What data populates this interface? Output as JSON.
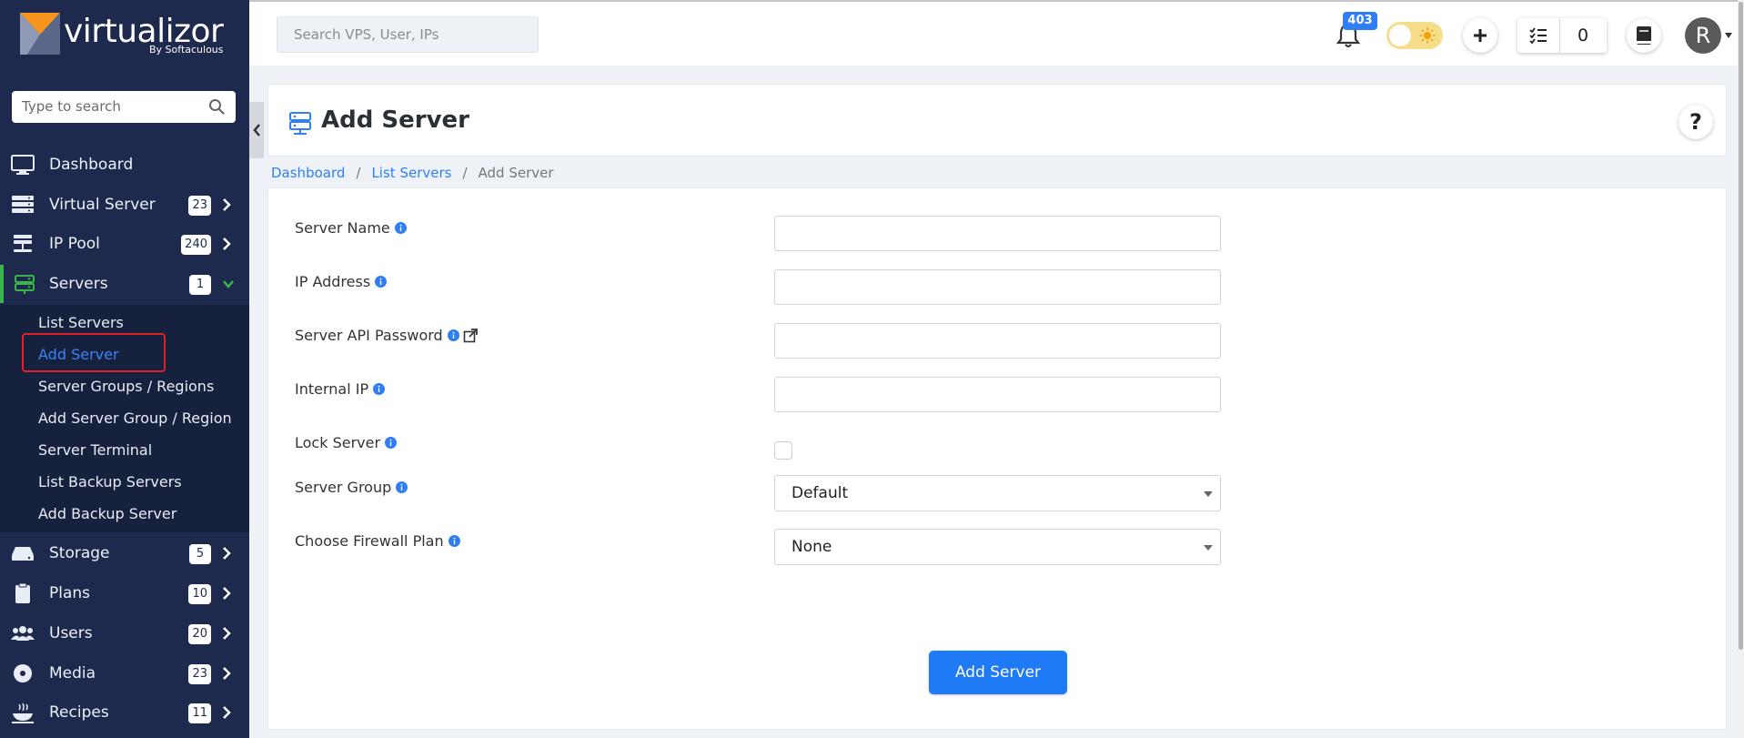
{
  "logo": {
    "name": "virtualizor",
    "by": "By Softaculous"
  },
  "sidebar": {
    "search_placeholder": "Type to search",
    "items": [
      {
        "label": "Dashboard",
        "badge": null
      },
      {
        "label": "Virtual Server",
        "badge": "23"
      },
      {
        "label": "IP Pool",
        "badge": "240"
      },
      {
        "label": "Servers",
        "badge": "1"
      },
      {
        "label": "Storage",
        "badge": "5"
      },
      {
        "label": "Plans",
        "badge": "10"
      },
      {
        "label": "Users",
        "badge": "20"
      },
      {
        "label": "Media",
        "badge": "23"
      },
      {
        "label": "Recipes",
        "badge": "11"
      }
    ],
    "servers_submenu": [
      "List Servers",
      "Add Server",
      "Server Groups / Regions",
      "Add Server Group / Region",
      "Server Terminal",
      "List Backup Servers",
      "Add Backup Server"
    ]
  },
  "header": {
    "search_placeholder": "Search VPS, User, IPs",
    "notifications_count": "403",
    "tasks_count": "0",
    "avatar_initial": "R"
  },
  "page": {
    "title": "Add Server",
    "help": "?",
    "breadcrumb": [
      "Dashboard",
      "List Servers",
      "Add Server"
    ]
  },
  "form": {
    "server_name_label": "Server Name",
    "ip_address_label": "IP Address",
    "api_password_label": "Server API Password",
    "internal_ip_label": "Internal IP",
    "lock_server_label": "Lock Server",
    "server_group_label": "Server Group",
    "server_group_value": "Default",
    "firewall_label": "Choose Firewall Plan",
    "firewall_value": "None",
    "submit_label": "Add Server"
  },
  "colors": {
    "sidebar_bg": "#1d2a4d",
    "accent": "#1f7af5",
    "active_indicator": "#3ab54a",
    "logo_orange": "#f7941d"
  }
}
